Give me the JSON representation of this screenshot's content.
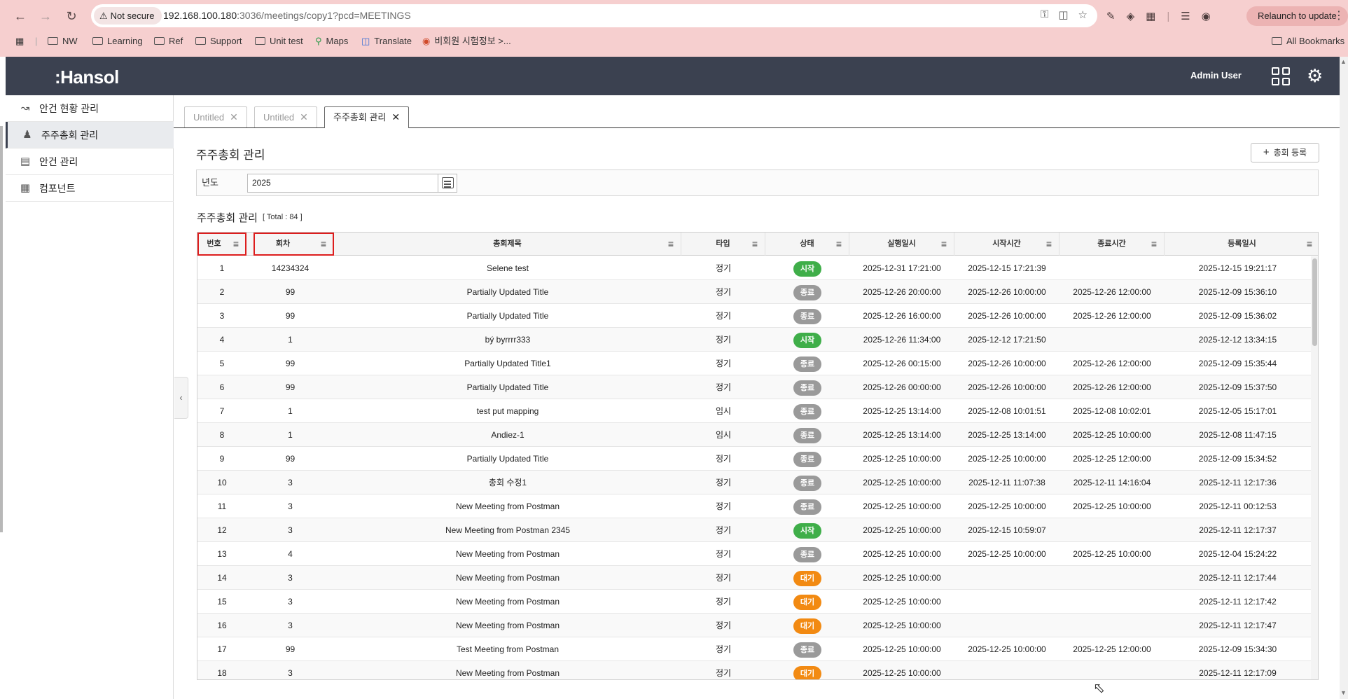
{
  "browser": {
    "security": "Not secure",
    "url_host": "192.168.100.180",
    "url_path": ":3036/meetings/copy1?pcd=MEETINGS",
    "relaunch_label": "Relaunch to update",
    "bookmarks": [
      "NW",
      "Learning",
      "Ref",
      "Support",
      "Unit test",
      "Maps",
      "Translate",
      "비회원 시험정보 >..."
    ],
    "all_bookmarks": "All Bookmarks"
  },
  "header": {
    "logo": ":Hansol",
    "user": "Admin User"
  },
  "sidebar": {
    "items": [
      {
        "label": "안건 현황 관리",
        "icon": "line-chart-icon",
        "active": false
      },
      {
        "label": "주주총회 관리",
        "icon": "users-icon",
        "active": true
      },
      {
        "label": "안건 관리",
        "icon": "document-icon",
        "active": false
      },
      {
        "label": "컴포넌트",
        "icon": "grid-icon",
        "active": false
      }
    ]
  },
  "tabs": [
    {
      "label": "Untitled",
      "active": false
    },
    {
      "label": "Untitled",
      "active": false
    },
    {
      "label": "주주총회 관리",
      "active": true
    }
  ],
  "page": {
    "title": "주주총회 관리",
    "add_button": "총회 등록",
    "filter_label": "년도",
    "filter_value": "2025",
    "list_title": "주주총회 관리",
    "list_total": "[ Total : 84 ]"
  },
  "status_colors": {
    "시작": "#3fae49",
    "종료": "#9a9a9a",
    "대기": "#f28a12"
  },
  "table": {
    "columns": [
      "번호",
      "회차",
      "총회제목",
      "타입",
      "상태",
      "실행일시",
      "시작시간",
      "종료시간",
      "등록일시"
    ],
    "rows": [
      [
        "1",
        "14234324",
        "Selene test",
        "정기",
        "시작",
        "2025-12-31 17:21:00",
        "2025-12-15 17:21:39",
        "",
        "2025-12-15 19:21:17"
      ],
      [
        "2",
        "99",
        "Partially Updated Title",
        "정기",
        "종료",
        "2025-12-26 20:00:00",
        "2025-12-26 10:00:00",
        "2025-12-26 12:00:00",
        "2025-12-09 15:36:10"
      ],
      [
        "3",
        "99",
        "Partially Updated Title",
        "정기",
        "종료",
        "2025-12-26 16:00:00",
        "2025-12-26 10:00:00",
        "2025-12-26 12:00:00",
        "2025-12-09 15:36:02"
      ],
      [
        "4",
        "1",
        "bý byrrrr333",
        "정기",
        "시작",
        "2025-12-26 11:34:00",
        "2025-12-12 17:21:50",
        "",
        "2025-12-12 13:34:15"
      ],
      [
        "5",
        "99",
        "Partially Updated Title1",
        "정기",
        "종료",
        "2025-12-26 00:15:00",
        "2025-12-26 10:00:00",
        "2025-12-26 12:00:00",
        "2025-12-09 15:35:44"
      ],
      [
        "6",
        "99",
        "Partially Updated Title",
        "정기",
        "종료",
        "2025-12-26 00:00:00",
        "2025-12-26 10:00:00",
        "2025-12-26 12:00:00",
        "2025-12-09 15:37:50"
      ],
      [
        "7",
        "1",
        "test put mapping",
        "임시",
        "종료",
        "2025-12-25 13:14:00",
        "2025-12-08 10:01:51",
        "2025-12-08 10:02:01",
        "2025-12-05 15:17:01"
      ],
      [
        "8",
        "1",
        "Andiez-1",
        "임시",
        "종료",
        "2025-12-25 13:14:00",
        "2025-12-25 13:14:00",
        "2025-12-25 10:00:00",
        "2025-12-08 11:47:15"
      ],
      [
        "9",
        "99",
        "Partially Updated Title",
        "정기",
        "종료",
        "2025-12-25 10:00:00",
        "2025-12-25 10:00:00",
        "2025-12-25 12:00:00",
        "2025-12-09 15:34:52"
      ],
      [
        "10",
        "3",
        "총회 수정1",
        "정기",
        "종료",
        "2025-12-25 10:00:00",
        "2025-12-11 11:07:38",
        "2025-12-11 14:16:04",
        "2025-12-11 12:17:36"
      ],
      [
        "11",
        "3",
        "New Meeting from Postman",
        "정기",
        "종료",
        "2025-12-25 10:00:00",
        "2025-12-25 10:00:00",
        "2025-12-25 10:00:00",
        "2025-12-11 00:12:53"
      ],
      [
        "12",
        "3",
        "New Meeting from Postman 2345",
        "정기",
        "시작",
        "2025-12-25 10:00:00",
        "2025-12-15 10:59:07",
        "",
        "2025-12-11 12:17:37"
      ],
      [
        "13",
        "4",
        "New Meeting from Postman",
        "정기",
        "종료",
        "2025-12-25 10:00:00",
        "2025-12-25 10:00:00",
        "2025-12-25 10:00:00",
        "2025-12-04 15:24:22"
      ],
      [
        "14",
        "3",
        "New Meeting from Postman",
        "정기",
        "대기",
        "2025-12-25 10:00:00",
        "",
        "",
        "2025-12-11 12:17:44"
      ],
      [
        "15",
        "3",
        "New Meeting from Postman",
        "정기",
        "대기",
        "2025-12-25 10:00:00",
        "",
        "",
        "2025-12-11 12:17:42"
      ],
      [
        "16",
        "3",
        "New Meeting from Postman",
        "정기",
        "대기",
        "2025-12-25 10:00:00",
        "",
        "",
        "2025-12-11 12:17:47"
      ],
      [
        "17",
        "99",
        "Test Meeting from Postman",
        "정기",
        "종료",
        "2025-12-25 10:00:00",
        "2025-12-25 10:00:00",
        "2025-12-25 12:00:00",
        "2025-12-09 15:34:30"
      ],
      [
        "18",
        "3",
        "New Meeting from Postman",
        "정기",
        "대기",
        "2025-12-25 10:00:00",
        "",
        "",
        "2025-12-11 12:17:09"
      ]
    ]
  }
}
